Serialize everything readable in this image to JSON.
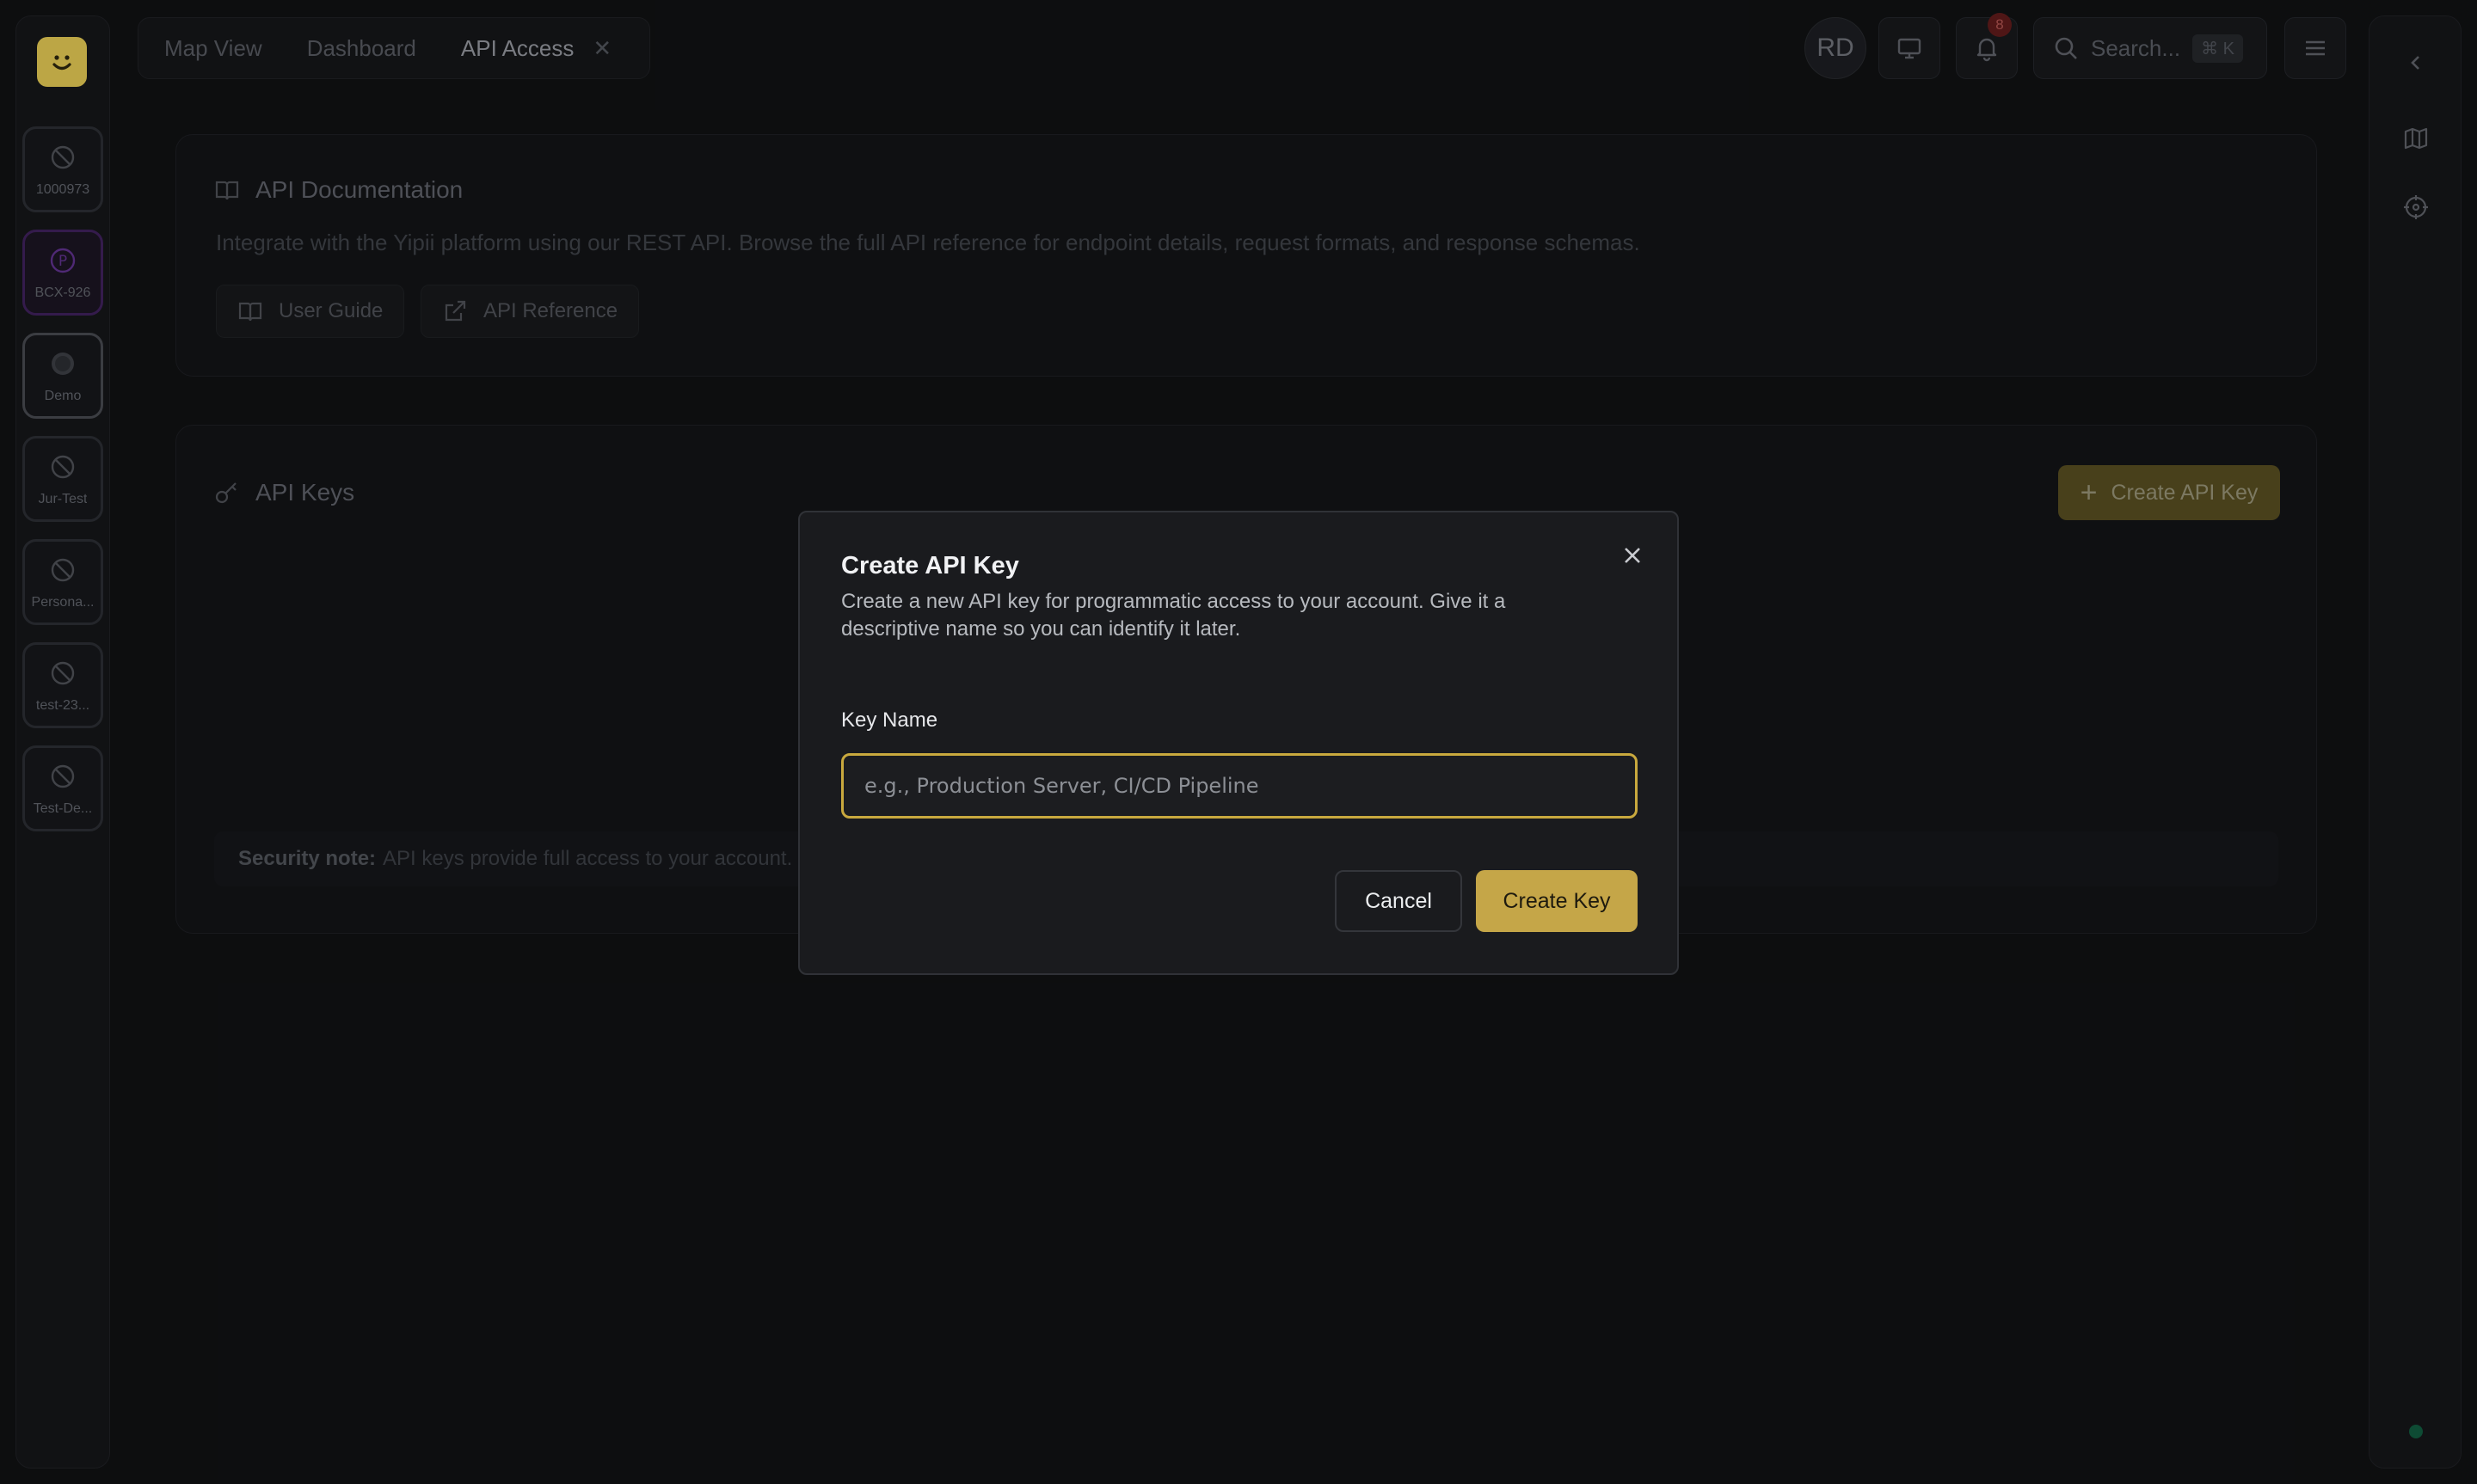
{
  "app": {
    "logo_icon": "smiley-logo-icon",
    "accent_color": "#d6bd4f"
  },
  "workspaces": [
    {
      "label": "1000973",
      "icon": "eye-off-icon"
    },
    {
      "label": "BCX-926",
      "icon": "letter-p-icon"
    },
    {
      "label": "Demo",
      "icon": "circle-icon"
    },
    {
      "label": "Jur-Test",
      "icon": "eye-off-icon"
    },
    {
      "label": "Persona...",
      "icon": "eye-off-icon"
    },
    {
      "label": "test-23...",
      "icon": "eye-off-icon"
    },
    {
      "label": "Test-De...",
      "icon": "eye-off-icon"
    }
  ],
  "tabs": [
    {
      "label": "Map View"
    },
    {
      "label": "Dashboard"
    },
    {
      "label": "API Access",
      "active": true
    }
  ],
  "header": {
    "avatar_initials": "RD",
    "notification_count": "8",
    "search_placeholder": "Search...",
    "search_shortcut": "⌘ K"
  },
  "docs_card": {
    "title": "API Documentation",
    "description": "Integrate with the Yipii platform using our REST API. Browse the full API reference for endpoint details, request formats, and response schemas.",
    "user_guide_label": "User Guide",
    "api_reference_label": "API Reference"
  },
  "keys_card": {
    "title": "API Keys",
    "create_button_label": "Create API Key",
    "security_note_label": "Security note:",
    "security_note_text": "API keys provide full access to your account."
  },
  "dialog": {
    "title": "Create API Key",
    "description": "Create a new API key for programmatic access to your account. Give it a descriptive name so you can identify it later.",
    "field_label": "Key Name",
    "field_placeholder": "e.g., Production Server, CI/CD Pipeline",
    "field_value": "",
    "cancel_label": "Cancel",
    "submit_label": "Create Key"
  }
}
